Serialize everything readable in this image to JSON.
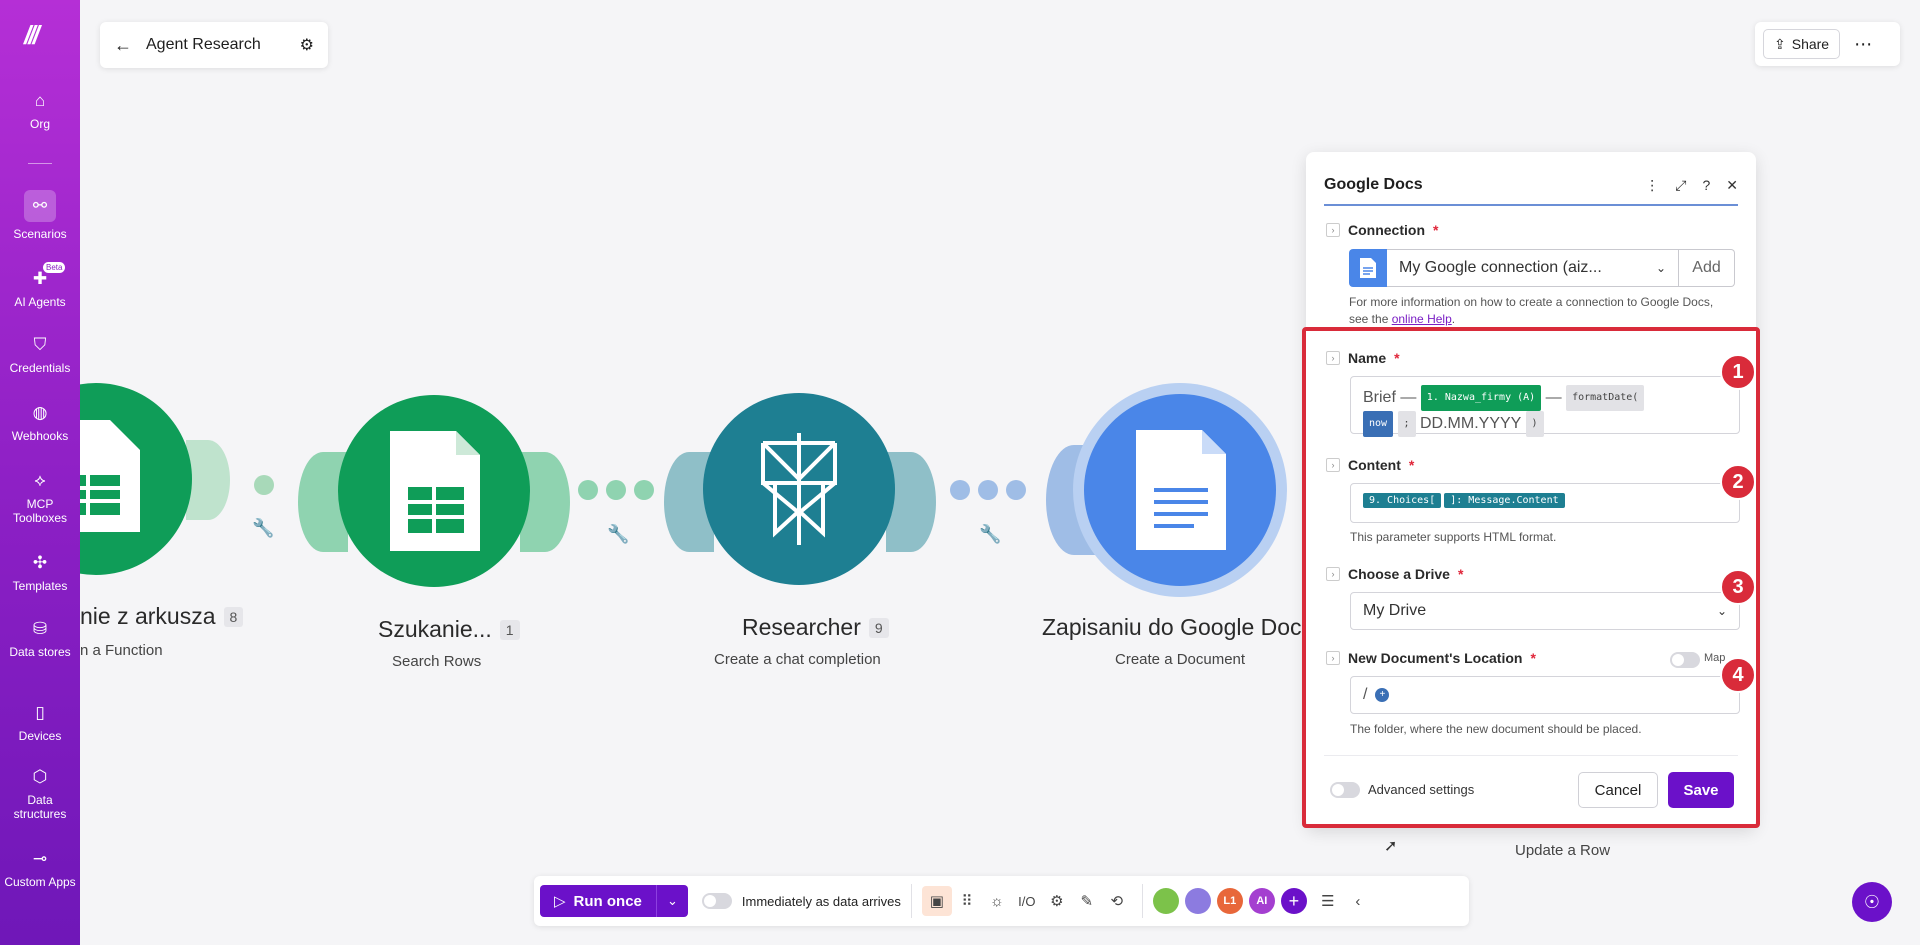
{
  "sidebar": {
    "items": [
      {
        "label": "Org",
        "icon": "home-icon"
      },
      {
        "label": "Scenarios",
        "icon": "share-icon"
      },
      {
        "label": "AI Agents",
        "icon": "ai-agent-icon",
        "badge": "Beta"
      },
      {
        "label": "Credentials",
        "icon": "shield-icon"
      },
      {
        "label": "Webhooks",
        "icon": "globe-icon"
      },
      {
        "label": "MCP Toolboxes",
        "icon": "mcp-icon"
      },
      {
        "label": "Templates",
        "icon": "puzzle-icon"
      },
      {
        "label": "Data stores",
        "icon": "database-icon"
      },
      {
        "label": "Devices",
        "icon": "phone-icon"
      },
      {
        "label": "Data structures",
        "icon": "cube-icon"
      },
      {
        "label": "Custom Apps",
        "icon": "connector-icon"
      }
    ]
  },
  "header": {
    "title": "Agent Research",
    "share_label": "Share"
  },
  "nodes": [
    {
      "title": "nie z arkusza",
      "count": "8",
      "subtitle": "n a Function"
    },
    {
      "title": "Szukanie...",
      "count": "1",
      "subtitle": "Search Rows"
    },
    {
      "title": "Researcher",
      "count": "9",
      "subtitle": "Create a chat completion"
    },
    {
      "title": "Zapisaniu do Google Doc",
      "count": "",
      "subtitle": "Create a Document"
    },
    {
      "title": "",
      "count": "",
      "subtitle": "Update a Row"
    }
  ],
  "panel": {
    "title": "Google Docs",
    "connection": {
      "label": "Connection",
      "value": "My Google connection (aiz...",
      "add_label": "Add",
      "help_prefix": "For more information on how to create a connection to Google Docs, see the ",
      "help_link": "online Help",
      "help_suffix": "."
    },
    "name": {
      "label": "Name",
      "text1": "Brief —",
      "pill1": "1. Nazwa_firmy (A)",
      "text2": "—",
      "pill2": "formatDate(",
      "pill3": "now",
      "pill4": ";",
      "text3": "DD.MM.YYYY",
      "pill5": ")"
    },
    "content": {
      "label": "Content",
      "pill1": "9. Choices[",
      "pill2": "]: Message.Content",
      "help": "This parameter supports HTML format."
    },
    "drive": {
      "label": "Choose a Drive",
      "value": "My Drive"
    },
    "location": {
      "label": "New Document's Location",
      "map_label": "Map",
      "value": "/",
      "help": "The folder, where the new document should be placed."
    },
    "advanced_label": "Advanced settings",
    "cancel_label": "Cancel",
    "save_label": "Save"
  },
  "markers": [
    "1",
    "2",
    "3",
    "4"
  ],
  "toolbar": {
    "run_label": "Run once",
    "toggle_label": "Immediately as data arrives",
    "apps": [
      {
        "label": "",
        "color": "#7cc24a"
      },
      {
        "label": "",
        "color": "#8c7be0"
      },
      {
        "label": "L1",
        "color": "#e8673a"
      },
      {
        "label": "AI",
        "color": "#a43fd0"
      }
    ]
  },
  "colors": {
    "accent": "#6b11c9",
    "sheets_green": "#0f9d58",
    "researcher_teal": "#1e7f92",
    "docs_blue": "#4a86e8",
    "annotation_red": "#d92b3a"
  }
}
